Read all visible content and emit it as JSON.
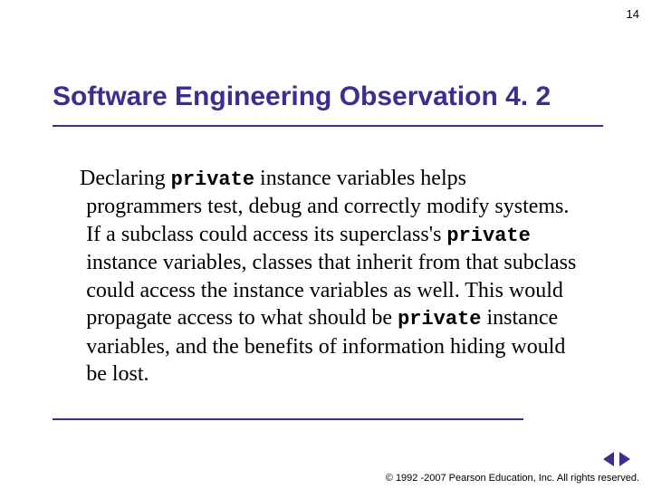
{
  "pageNumber": "14",
  "title": "Software Engineering Observation 4. 2",
  "body": {
    "p1_a": "Declaring ",
    "code1": "private",
    "p1_b": " instance variables helps programmers test, debug and correctly modify systems. If a subclass could access its superclass's ",
    "code2": "private",
    "p1_c": " instance variables, classes that inherit from that subclass could access the instance variables as well. This would propagate access to what should be ",
    "code3": "private",
    "p1_d": " instance variables, and the benefits of information hiding would be lost."
  },
  "footer": "© 1992 -2007 Pearson Education, Inc. All rights reserved."
}
